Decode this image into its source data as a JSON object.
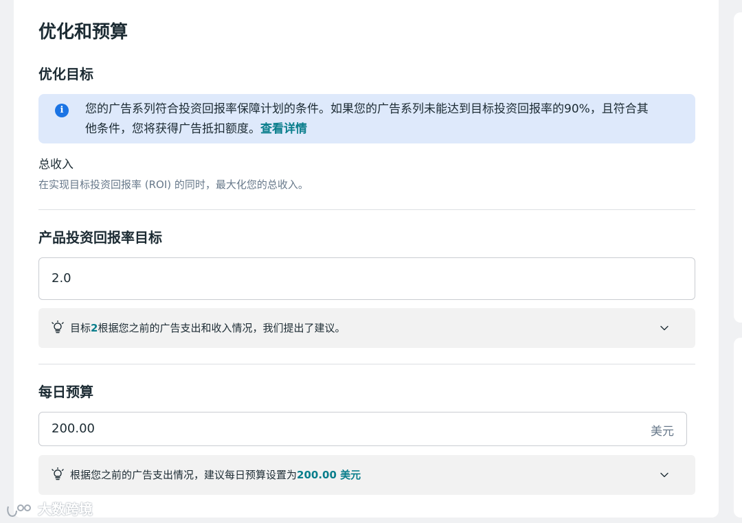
{
  "section": {
    "title": "优化和预算",
    "subtitle": "优化目标"
  },
  "info": {
    "text": "您的广告系列符合投资回报率保障计划的条件。如果您的广告系列未能达到目标投资回报率的90%，且符合其他条件，您将获得广告抵扣额度。",
    "link": "查看详情",
    "icon": "info-icon",
    "bg_color": "#dee9fb"
  },
  "optimization": {
    "name": "总收入",
    "description": "在实现目标投资回报率 (ROI) 的同时，最大化您的总收入。"
  },
  "roi_target": {
    "title": "产品投资回报率目标",
    "value": "2.0",
    "suggestion_prefix": "目标",
    "suggestion_value": "2",
    "suggestion_suffix": "根据您之前的广告支出和收入情况，我们提出了建议。"
  },
  "daily_budget": {
    "title": "每日预算",
    "value": "200.00",
    "currency": "美元",
    "suggestion_text": "根据您之前的广告支出情况，建议每日预算设置为",
    "suggestion_value": "200.00 美元"
  },
  "watermark": {
    "text": "大数跨境"
  },
  "colors": {
    "accent": "#0a7e8c",
    "info_icon": "#1b74e4"
  }
}
